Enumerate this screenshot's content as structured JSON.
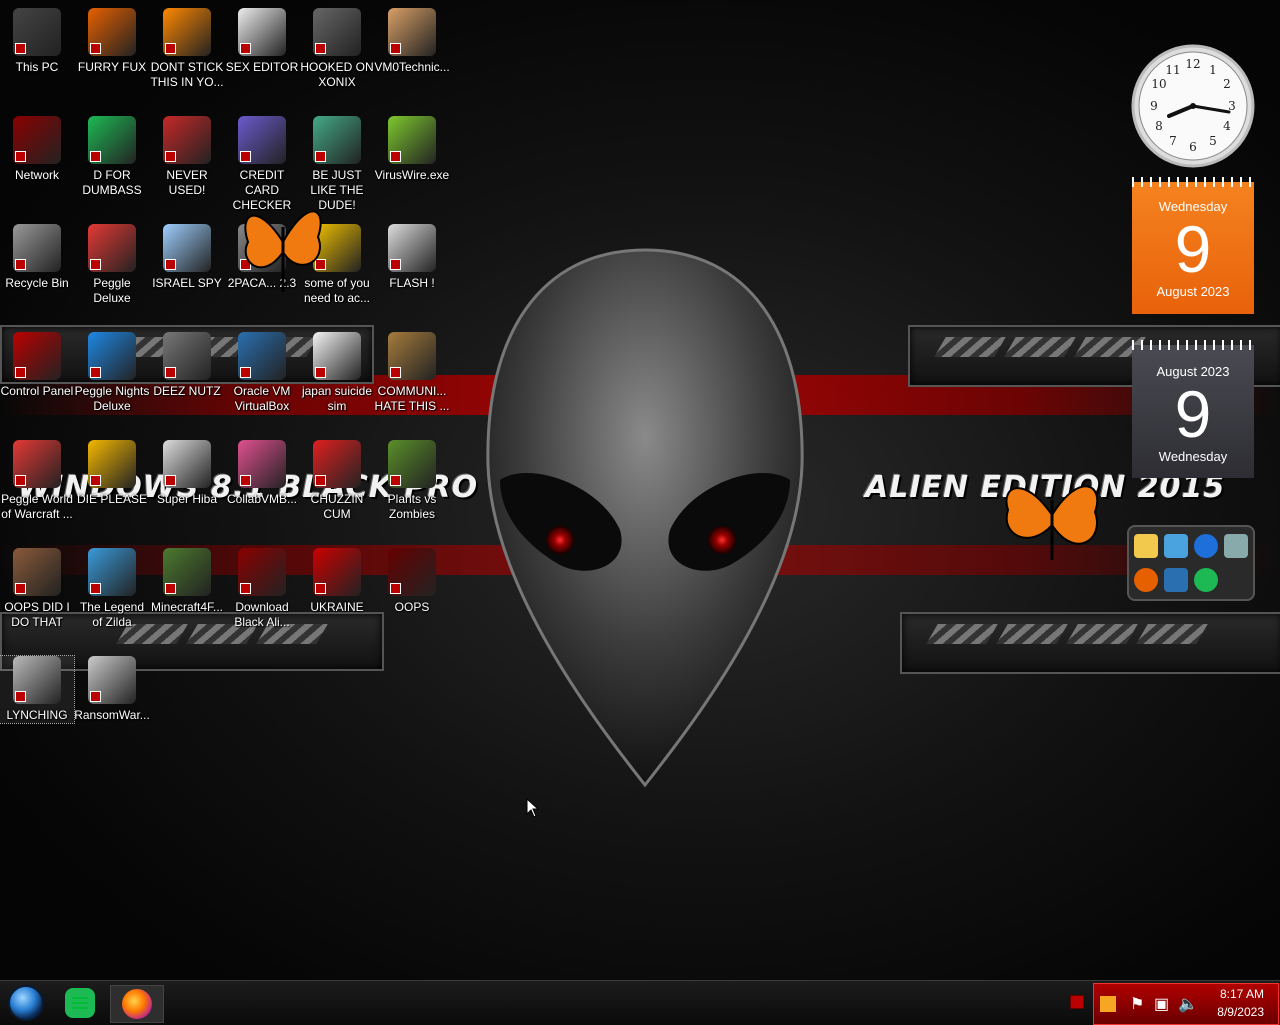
{
  "wallpaper": {
    "left_text": "WINDOWS 8.1 BLACK PRO",
    "right_text": "ALIEN EDITION 2015"
  },
  "icons": [
    {
      "label": "This PC",
      "color": "#444"
    },
    {
      "label": "FURRY FUX",
      "color": "#e66000"
    },
    {
      "label": "DONT STICK THIS IN YO...",
      "color": "#f80"
    },
    {
      "label": "SEX EDITOR",
      "color": "#eee"
    },
    {
      "label": "HOOKED ON XONIX",
      "color": "#666"
    },
    {
      "label": "VM0Technic...",
      "color": "#d9a066"
    },
    {
      "label": "Network",
      "color": "#8a0000"
    },
    {
      "label": "D FOR DUMBASS",
      "color": "#1db954"
    },
    {
      "label": "NEVER USED!",
      "color": "#c62828"
    },
    {
      "label": "CREDIT CARD CHECKER",
      "color": "#6a5acd"
    },
    {
      "label": "BE JUST LIKE THE DUDE!",
      "color": "#4a8"
    },
    {
      "label": "VirusWire.exe",
      "color": "#7ec82e"
    },
    {
      "label": "Recycle Bin",
      "color": "#999"
    },
    {
      "label": "Peggle Deluxe",
      "color": "#e53935"
    },
    {
      "label": "ISRAEL SPY",
      "color": "#9ecfff"
    },
    {
      "label": "2PACA... 2.3",
      "color": "#888"
    },
    {
      "label": "some of you need to ac...",
      "color": "#f2c200"
    },
    {
      "label": "FLASH !",
      "color": "#ddd"
    },
    {
      "label": "Control Panel",
      "color": "#b00"
    },
    {
      "label": "Peggle Nights Deluxe",
      "color": "#1e88e5"
    },
    {
      "label": "DEEZ NUTZ",
      "color": "#777"
    },
    {
      "label": "Oracle VM VirtualBox",
      "color": "#2a6fb0"
    },
    {
      "label": "japan suicide sim",
      "color": "#f5f5f5"
    },
    {
      "label": "COMMUNI... HATE THIS ...",
      "color": "#a67c3d"
    },
    {
      "label": "Peggle World of Warcraft ...",
      "color": "#e53935"
    },
    {
      "label": "DIE PLEASE",
      "color": "#f5b800"
    },
    {
      "label": "Super Hiba",
      "color": "#ddd"
    },
    {
      "label": "CollabVMB...",
      "color": "#e05090"
    },
    {
      "label": "CHUZZIN CUM",
      "color": "#e02020"
    },
    {
      "label": "Plants vs Zombies",
      "color": "#5a8f29"
    },
    {
      "label": "OOPS DID I DO THAT",
      "color": "#8a5a3a"
    },
    {
      "label": "The Legend of Zilda",
      "color": "#3a9ad9"
    },
    {
      "label": "Minecraft4F...",
      "color": "#4c7a2e"
    },
    {
      "label": "Download Black Ali...",
      "color": "#8a0000"
    },
    {
      "label": "UKRAINE",
      "color": "#c00"
    },
    {
      "label": "OOPS",
      "color": "#600"
    },
    {
      "label": "LYNCHING",
      "color": "#bbb"
    },
    {
      "label": "RansomWar...",
      "color": "#ccc"
    }
  ],
  "gadgets": {
    "clock": {
      "time": "8:17"
    },
    "calendar_orange": {
      "weekday": "Wednesday",
      "day": "9",
      "month_year": "August 2023"
    },
    "calendar_dark": {
      "month_year": "August 2023",
      "day": "9",
      "weekday": "Wednesday"
    }
  },
  "taskbar": {
    "buttons": [
      "start-orb",
      "chat-app",
      "firefox"
    ],
    "time": "8:17 AM",
    "date": "8/9/2023"
  }
}
